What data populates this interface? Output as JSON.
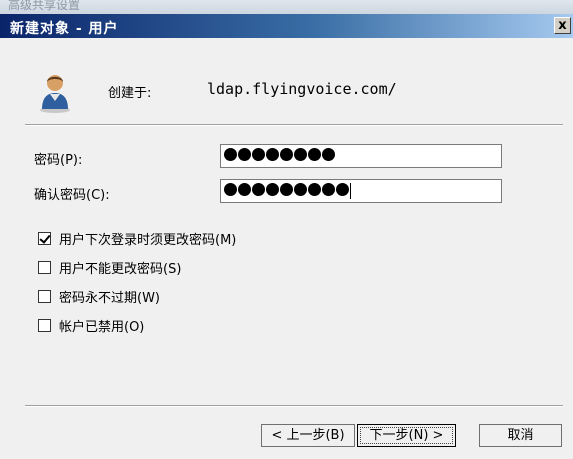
{
  "window": {
    "title": "新建对象 - 用户",
    "close_glyph": "x",
    "background_title": "高级共享设置"
  },
  "header": {
    "icon": "user-icon",
    "created_label": "创建于:",
    "created_value": "ldap.flyingvoice.com/"
  },
  "fields": {
    "password_label": "密码(P):",
    "password_dots": 8,
    "confirm_label": "确认密码(C):",
    "confirm_dots": 9
  },
  "options": [
    {
      "label": "用户下次登录时须更改密码(M)",
      "checked": true
    },
    {
      "label": "用户不能更改密码(S)",
      "checked": false
    },
    {
      "label": "密码永不过期(W)",
      "checked": false
    },
    {
      "label": "帐户已禁用(O)",
      "checked": false
    }
  ],
  "buttons": {
    "back": "< 上一步(B)",
    "next": "下一步(N) >",
    "cancel": "取消"
  },
  "colors": {
    "title_gradient_start": "#0a246a",
    "title_gradient_end": "#a6caf0",
    "dialog_bg": "#f0f0f0"
  }
}
